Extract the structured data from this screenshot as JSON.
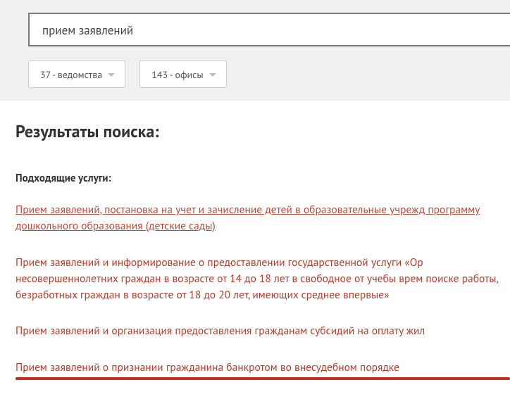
{
  "search": {
    "value": "прием заявлений"
  },
  "filters": {
    "departments": "37 - ведомства",
    "offices": "143 - офисы"
  },
  "headings": {
    "results": "Результаты поиска:",
    "matching": "Подходящие услуги:"
  },
  "results": [
    "Прием заявлений, постановка на учет и зачисление детей в образовательные учрежд программу дошкольного образования (детские сады)",
    "Прием заявлений и информирование о предоставлении государственной услуги «Ор несовершеннолетних граждан в возрасте от 14 до 18 лет в свободное от учебы врем поиске работы, безработных граждан в возрасте от 18 до 20 лет, имеющих среднее впервые»",
    "Прием заявлений и организация предоставления гражданам субсидий на оплату жил",
    "Прием заявлений о признании гражданина банкротом во внесудебном порядке"
  ]
}
